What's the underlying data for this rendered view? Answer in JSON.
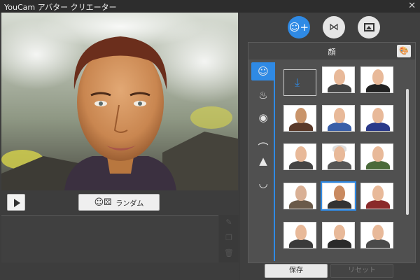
{
  "window": {
    "title": "YouCam アバター クリエーター"
  },
  "controls": {
    "random_label": "ランダム"
  },
  "right": {
    "panel_title": "顔",
    "tabs": [
      {
        "icon": "face-add-icon",
        "active": true
      },
      {
        "icon": "bowtie-icon",
        "active": false
      },
      {
        "icon": "background-image-icon",
        "active": false
      }
    ],
    "categories": [
      "face-icon",
      "hair-icon",
      "eye-icon",
      "eyebrow-icon",
      "nose-icon",
      "lips-icon"
    ],
    "selected_tile": 10
  },
  "footer": {
    "save_label": "保存",
    "reset_label": "リセット"
  },
  "colors": {
    "accent": "#2f8ae5",
    "panel": "#505050",
    "background": "#3b3b3b"
  }
}
